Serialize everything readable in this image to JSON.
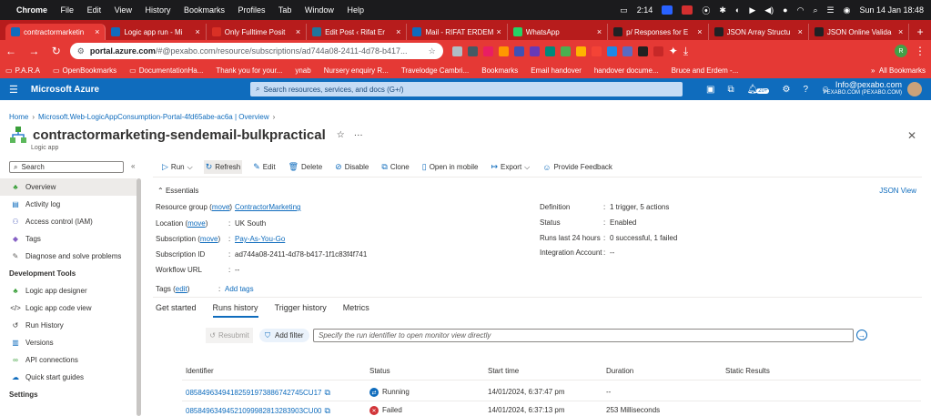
{
  "macbar": {
    "app": "Chrome",
    "menus": [
      "File",
      "Edit",
      "View",
      "History",
      "Bookmarks",
      "Profiles",
      "Tab",
      "Window",
      "Help"
    ],
    "time": "2:14",
    "datetime": "Sun 14 Jan  18:48"
  },
  "tabs": [
    {
      "title": "contractormarketin",
      "color": "#0f6cbd"
    },
    {
      "title": "Logic app run - Mi",
      "color": "#0f6cbd"
    },
    {
      "title": "Only Fulltime Posit",
      "color": "#d93025"
    },
    {
      "title": "Edit Post ‹ Rifat Er",
      "color": "#21759b"
    },
    {
      "title": "Mail - RIFAT ERDEM",
      "color": "#0f6cbd"
    },
    {
      "title": "WhatsApp",
      "color": "#25d366"
    },
    {
      "title": "p/ Responses for E",
      "color": "#202124"
    },
    {
      "title": "JSON Array Structu",
      "color": "#202124"
    },
    {
      "title": "JSON Online Valida",
      "color": "#202124"
    }
  ],
  "address": {
    "host": "portal.azure.com",
    "path": "/#@pexabo.com/resource/subscriptions/ad744a08-2411-4d78-b417..."
  },
  "bookmarks": [
    "P.A.R.A",
    "OpenBookmarks",
    "DocumentationHa...",
    "Thank you for your...",
    "ynab",
    "Nursery enquiry R...",
    "Travelodge Cambri...",
    "Bookmarks",
    "Email handover",
    "handover docume...",
    "Bruce and Erdem -...",
    "All Bookmarks"
  ],
  "azure": {
    "brand": "Microsoft Azure",
    "search_placeholder": "Search resources, services, and docs (G+/)",
    "badge": "20+",
    "account_email": "Info@pexabo.com",
    "account_tenant": "PEXABO.COM (PEXABO.COM)"
  },
  "breadcrumb": {
    "home": "Home",
    "resource": "Microsoft.Web-LogicAppConsumption-Portal-4fd65abe-ac6a | Overview"
  },
  "header": {
    "title": "contractormarketing-sendemail-bulkpractical",
    "subtitle": "Logic app"
  },
  "sidebar": {
    "search_placeholder": "Search",
    "items": [
      {
        "label": "Overview",
        "icon": "logic-app-icon",
        "color": "#3a9f3a",
        "active": true
      },
      {
        "label": "Activity log",
        "icon": "activity-log-icon",
        "color": "#0f6cbd"
      },
      {
        "label": "Access control (IAM)",
        "icon": "people-icon",
        "color": "#5c6bc0"
      },
      {
        "label": "Tags",
        "icon": "tag-icon",
        "color": "#8661c5"
      },
      {
        "label": "Diagnose and solve problems",
        "icon": "wrench-icon",
        "color": "#605e5c"
      }
    ],
    "section1": "Development Tools",
    "dev_items": [
      {
        "label": "Logic app designer",
        "icon": "designer-icon",
        "color": "#3a9f3a"
      },
      {
        "label": "Logic app code view",
        "icon": "code-icon",
        "color": "#323130"
      },
      {
        "label": "Run History",
        "icon": "history-icon",
        "color": "#323130"
      },
      {
        "label": "Versions",
        "icon": "versions-icon",
        "color": "#0f6cbd"
      },
      {
        "label": "API connections",
        "icon": "link-icon",
        "color": "#3a9f3a"
      },
      {
        "label": "Quick start guides",
        "icon": "cloud-icon",
        "color": "#0f6cbd"
      }
    ],
    "section2": "Settings"
  },
  "toolbar": {
    "run": "Run",
    "refresh": "Refresh",
    "edit": "Edit",
    "delete": "Delete",
    "disable": "Disable",
    "clone": "Clone",
    "open_mobile": "Open in mobile",
    "export": "Export",
    "feedback": "Provide Feedback"
  },
  "essentials": {
    "title": "Essentials",
    "json_view": "JSON View",
    "resource_group_label": "Resource group",
    "move": "move",
    "resource_group": "ContractorMarketing",
    "location_label": "Location",
    "location": "UK South",
    "subscription_label": "Subscription",
    "subscription": "Pay-As-You-Go",
    "subscription_id_label": "Subscription ID",
    "subscription_id": "ad744a08-2411-4d78-b417-1f1c83f4f741",
    "workflow_url_label": "Workflow URL",
    "workflow_url": "--",
    "definition_label": "Definition",
    "definition": "1 trigger, 5 actions",
    "status_label": "Status",
    "status": "Enabled",
    "runs_label": "Runs last 24 hours",
    "runs": "0 successful, 1 failed",
    "integration_label": "Integration Account",
    "integration": "--",
    "tags_label": "Tags",
    "edit": "edit",
    "add_tags": "Add tags"
  },
  "tabs2": [
    "Get started",
    "Runs history",
    "Trigger history",
    "Metrics"
  ],
  "runs": {
    "resubmit": "Resubmit",
    "add_filter": "Add filter",
    "input_placeholder": "Specify the run identifier to open monitor view directly",
    "columns": [
      "Identifier",
      "Status",
      "Start time",
      "Duration",
      "Static Results"
    ],
    "rows": [
      {
        "id": "08584963494182591973886742745CU17",
        "status": "Running",
        "start": "14/01/2024, 6:37:47 pm",
        "duration": "--",
        "status_color": "#0f6cbd"
      },
      {
        "id": "08584963494521099982813283903CU00",
        "status": "Failed",
        "start": "14/01/2024, 6:37:13 pm",
        "duration": "253 Milliseconds",
        "status_color": "#d13438"
      }
    ]
  }
}
